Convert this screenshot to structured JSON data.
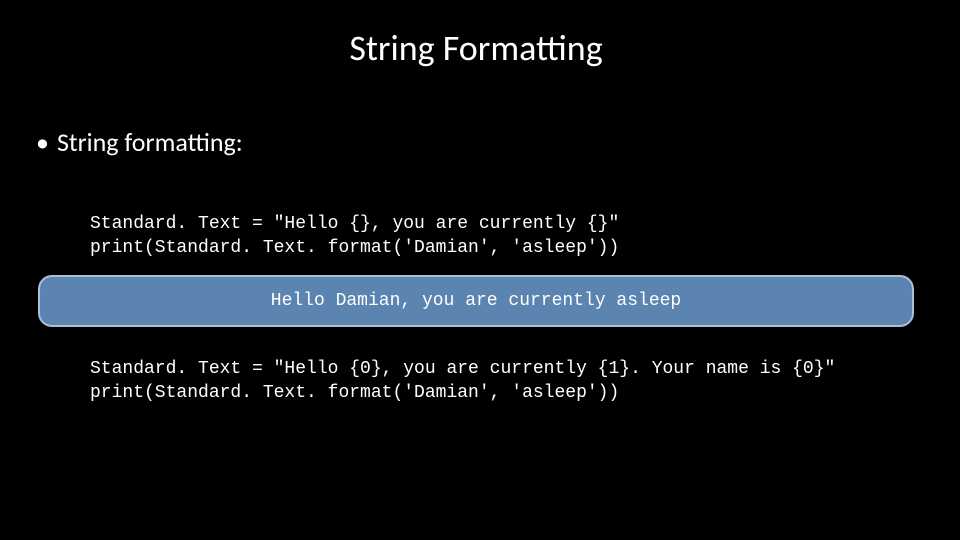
{
  "title": "String Formatting",
  "bullet": "String formatting:",
  "code1_line1": "Standard. Text = \"Hello {}, you are currently {}\"",
  "code1_line2": "print(Standard. Text. format('Damian', 'asleep'))",
  "output1": "Hello Damian, you are currently asleep",
  "code2_line1": "Standard. Text = \"Hello {0}, you are currently {1}. Your name is {0}\"",
  "code2_line2": "print(Standard. Text. format('Damian', 'asleep'))"
}
